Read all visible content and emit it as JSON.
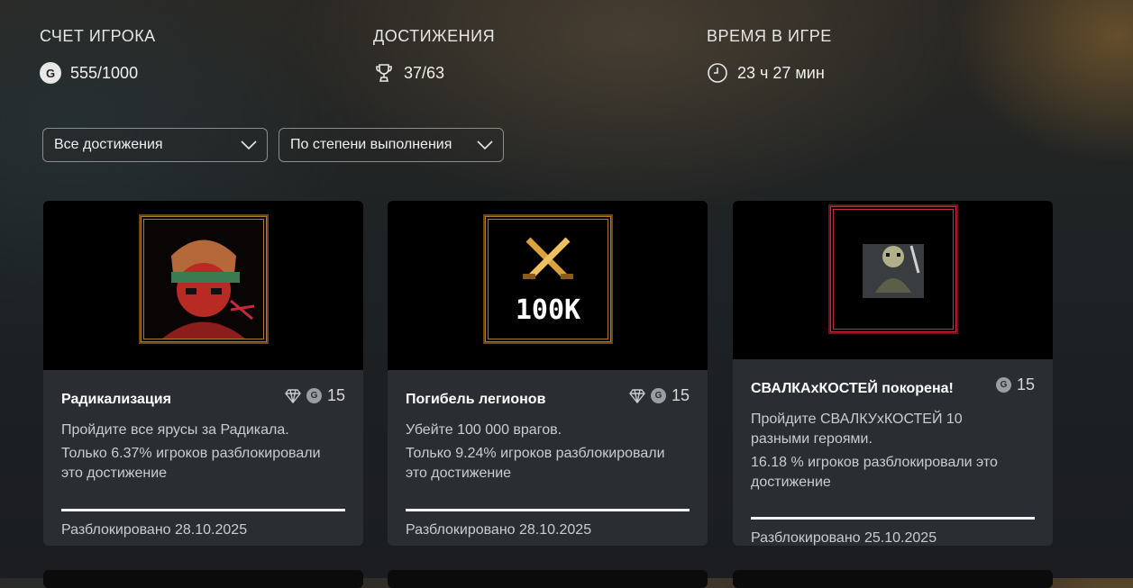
{
  "stats": {
    "score_label": "СЧЕТ ИГРОКА",
    "score_value": "555/1000",
    "achievements_label": "ДОСТИЖЕНИЯ",
    "achievements_value": "37/63",
    "time_label": "ВРЕМЯ В ИГРЕ",
    "time_value": "23 ч 27 мин"
  },
  "filters": {
    "filter_selected": "Все достижения",
    "sort_selected": "По степени выполнения"
  },
  "icons": {
    "gamerscore": "G"
  },
  "cards": [
    {
      "title": "Радикализация",
      "points": "15",
      "description": "Пройдите все ярусы за Радикала.",
      "rarity": "Только 6.37% игроков разблокировали это достижение",
      "unlocked": "Разблокировано 28.10.2025"
    },
    {
      "title": "Погибель легионов",
      "points": "15",
      "art_text": "100K",
      "description": "Убейте 100 000 врагов.",
      "rarity": "Только 9.24% игроков разблокировали это достижение",
      "unlocked": "Разблокировано 28.10.2025"
    },
    {
      "title": "СВАЛКАxКОСТЕЙ покорена!",
      "points": "15",
      "description": "Пройдите СВАЛКУxКОСТЕЙ 10 разными героями.",
      "rarity": "16.18 % игроков разблокировали это достижение",
      "unlocked": "Разблокировано 25.10.2025"
    }
  ],
  "colors": {
    "card_bg": "#2a2d32",
    "gold_frame": "#b07a2c",
    "red_frame": "#c42a3a"
  }
}
